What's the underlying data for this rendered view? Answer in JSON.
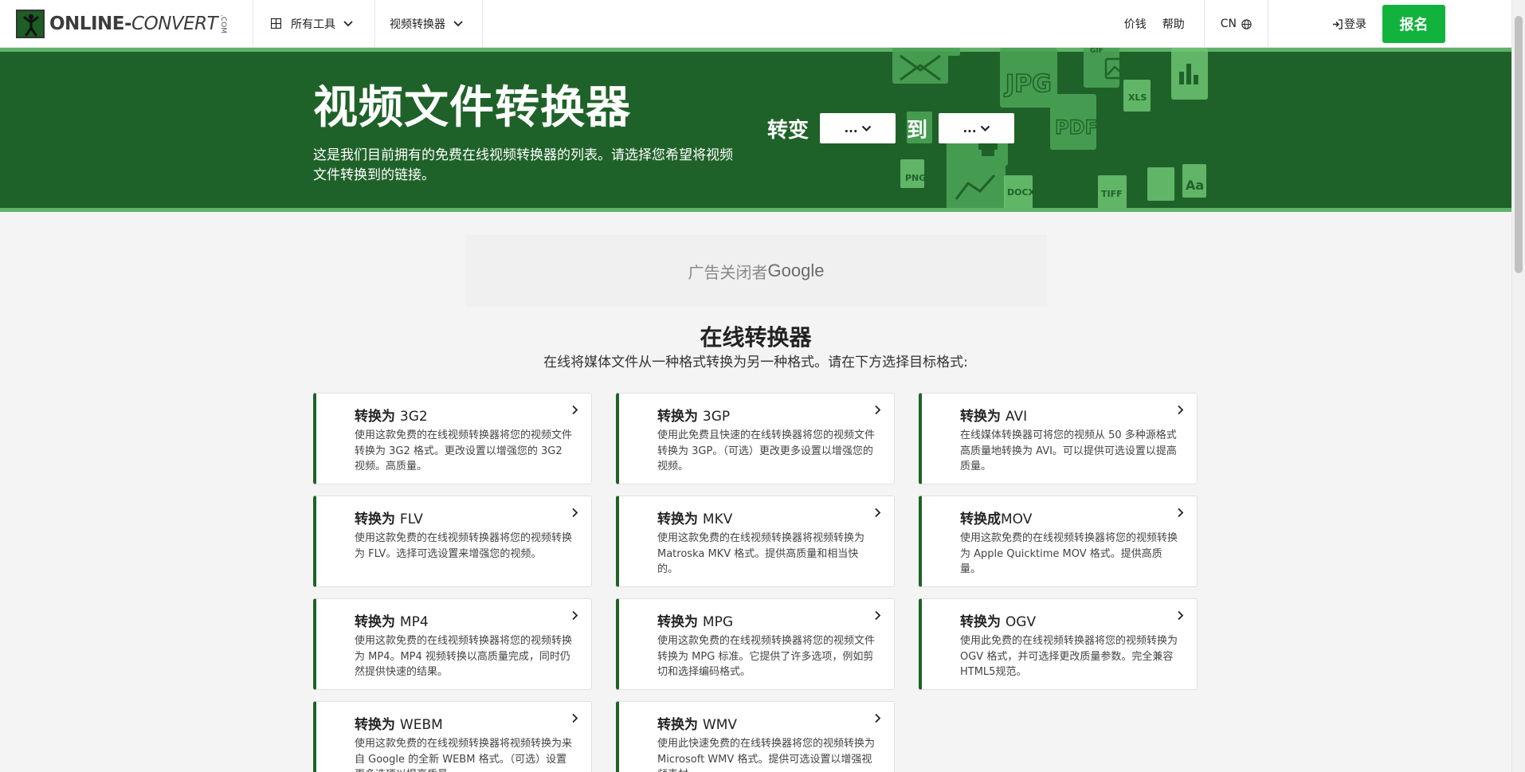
{
  "header": {
    "brand": "ONLINE-CONVERT",
    "brand_part1": "ONLINE-",
    "brand_part2": "CONVERT",
    "brand_suffix": ".COM",
    "nav_all_tools": "所有工具",
    "nav_video_converter": "视频转换器",
    "link_pricing": "价钱",
    "link_help": "帮助",
    "lang": "CN",
    "login": "登录",
    "signup": "报名"
  },
  "hero": {
    "title": "视频文件转换器",
    "description": "这是我们目前拥有的免费在线视频转换器的列表。请选择您希望将视频文件转换到的链接。",
    "convert_label": "转变",
    "to_label": "到",
    "from_select": "...",
    "to_select": "..."
  },
  "ad": {
    "prefix": "广告关闭者",
    "brand": "Google"
  },
  "section": {
    "title": "在线转换器",
    "subtitle": "在线将媒体文件从一种格式转换为另一种格式。请在下方选择目标格式:"
  },
  "cards": [
    {
      "prefix": "转换为",
      "format": "3G2",
      "desc": "使用这款免费的在线视频转换器将您的视频文件转换为 3G2 格式。更改设置以增强您的 3G2 视频。高质量。"
    },
    {
      "prefix": "转换为",
      "format": "3GP",
      "desc": "使用此免费且快速的在线转换器将您的视频文件转换为 3GP。（可选）更改更多设置以增强您的视频。"
    },
    {
      "prefix": "转换为",
      "format": "AVI",
      "desc": "在线媒体转换器可将您的视频从 50 多种源格式高质量地转换为 AVI。可以提供可选设置以提高质量。"
    },
    {
      "prefix": "转换为",
      "format": "FLV",
      "desc": "使用这款免费的在线视频转换器将您的视频转换为 FLV。选择可选设置来增强您的视频。"
    },
    {
      "prefix": "转换为",
      "format": "MKV",
      "desc": "使用这款免费的在线视频转换器将视频转换为 Matroska MKV 格式。提供高质量和相当快的。"
    },
    {
      "prefix": "转换成",
      "format": "MOV",
      "desc": "使用这款免费的在线视频转换器将您的视频转换为 Apple Quicktime MOV 格式。提供高质量。"
    },
    {
      "prefix": "转换为",
      "format": "MP4",
      "desc": "使用这款免费的在线视频转换器将您的视频转换为 MP4。MP4 视频转换以高质量完成，同时仍然提供快速的结果。"
    },
    {
      "prefix": "转换为",
      "format": "MPG",
      "desc": "使用这款免费的在线视频转换器将您的视频文件转换为 MPG 标准。它提供了许多选项，例如剪切和选择编码格式。"
    },
    {
      "prefix": "转换为",
      "format": "OGV",
      "desc": "使用此免费的在线视频转换器将您的视频转换为 OGV 格式，并可选择更改质量参数。完全兼容HTML5规范。"
    },
    {
      "prefix": "转换为",
      "format": "WEBM",
      "desc": "使用这款免费的在线视频转换器将视频转换为来自 Google 的全新 WEBM 格式。（可选）设置更多选项以提高质量。"
    },
    {
      "prefix": "转换为",
      "format": "WMV",
      "desc": "使用此快速免费的在线转换器将您的视频转换为 Microsoft WMV 格式。提供可选设置以增强视频素材。"
    }
  ],
  "hero_art_labels": [
    "JPG",
    "PDF",
    "PNG",
    "XLS",
    "DOCX",
    "TIFF",
    "Aa",
    "GIF"
  ],
  "colors": {
    "hero_green": "#1f6229",
    "accent_green": "#12b33c",
    "card_border": "#1f6229"
  }
}
